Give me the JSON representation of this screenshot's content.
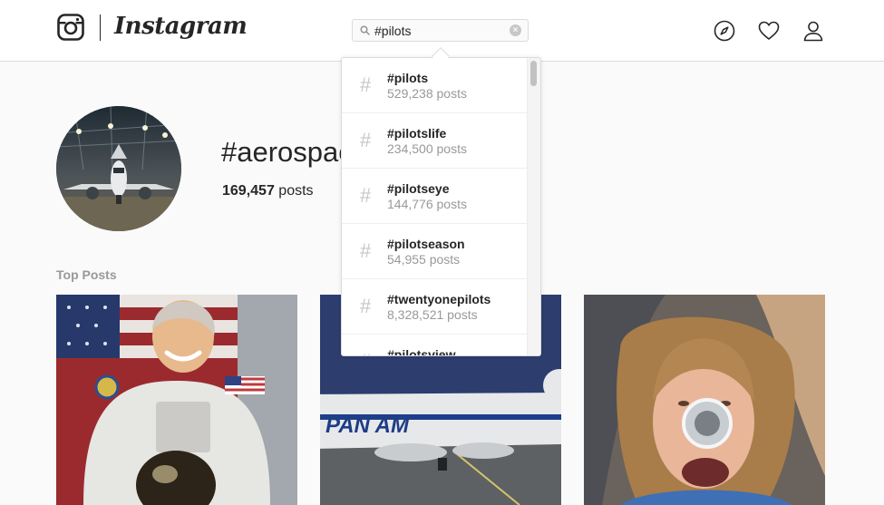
{
  "header": {
    "brand": "Instagram",
    "search": {
      "value": "#pilots",
      "placeholder": "Search"
    },
    "nav_icons": [
      "compass-icon",
      "heart-icon",
      "user-icon"
    ]
  },
  "tag": {
    "name": "#aerospace",
    "post_count": "169,457",
    "post_count_suffix": " posts"
  },
  "sections": {
    "top_posts_label": "Top Posts"
  },
  "search_results": [
    {
      "name": "#pilots",
      "count": "529,238 posts"
    },
    {
      "name": "#pilotslife",
      "count": "234,500 posts"
    },
    {
      "name": "#pilotseye",
      "count": "144,776 posts"
    },
    {
      "name": "#pilotseason",
      "count": "54,955 posts"
    },
    {
      "name": "#twentyonepilots",
      "count": "8,328,521 posts"
    },
    {
      "name": "#pilotsview",
      "count": ""
    }
  ],
  "colors": {
    "background": "#fafafa",
    "border": "#dbdbdb",
    "text": "#262626",
    "secondary_text": "#999999"
  }
}
